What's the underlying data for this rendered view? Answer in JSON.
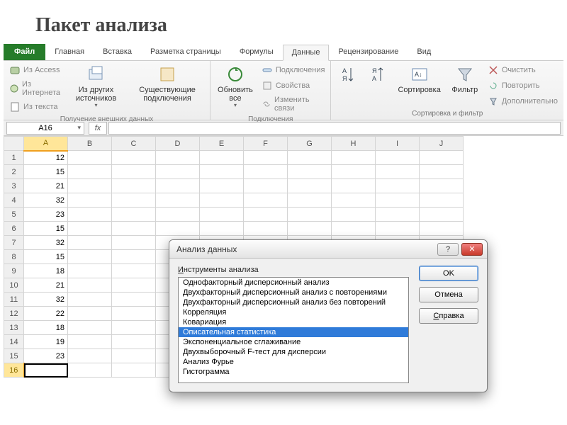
{
  "page_title": "Пакет анализа",
  "tabs": {
    "file": "Файл",
    "home": "Главная",
    "insert": "Вставка",
    "pagelayout": "Разметка страницы",
    "formulas": "Формулы",
    "data": "Данные",
    "review": "Рецензирование",
    "view": "Вид"
  },
  "ribbon": {
    "group_ext_data": {
      "label": "Получение внешних данных",
      "from_access": "Из Access",
      "from_web": "Из Интернета",
      "from_text": "Из текста",
      "from_other": "Из других источников",
      "existing_conn": "Существующие подключения"
    },
    "group_connections": {
      "label": "Подключения",
      "refresh_all": "Обновить все",
      "connections": "Подключения",
      "properties": "Свойства",
      "edit_links": "Изменить связи"
    },
    "group_sort": {
      "label": "Сортировка и фильтр",
      "sort": "Сортировка",
      "filter": "Фильтр",
      "clear": "Очистить",
      "reapply": "Повторить",
      "advanced": "Дополнительно"
    }
  },
  "namebox": "A16",
  "fx": "fx",
  "columns": [
    "A",
    "B",
    "C",
    "D",
    "E",
    "F",
    "G",
    "H",
    "I",
    "J"
  ],
  "rows": [
    {
      "n": "1",
      "a": "12"
    },
    {
      "n": "2",
      "a": "15"
    },
    {
      "n": "3",
      "a": "21"
    },
    {
      "n": "4",
      "a": "32"
    },
    {
      "n": "5",
      "a": "23"
    },
    {
      "n": "6",
      "a": "15"
    },
    {
      "n": "7",
      "a": "32"
    },
    {
      "n": "8",
      "a": "15"
    },
    {
      "n": "9",
      "a": "18"
    },
    {
      "n": "10",
      "a": "21"
    },
    {
      "n": "11",
      "a": "32"
    },
    {
      "n": "12",
      "a": "22"
    },
    {
      "n": "13",
      "a": "18"
    },
    {
      "n": "14",
      "a": "19"
    },
    {
      "n": "15",
      "a": "23"
    },
    {
      "n": "16",
      "a": ""
    }
  ],
  "dialog": {
    "title": "Анализ данных",
    "list_label_pre": "И",
    "list_label_rest": "нструменты анализа",
    "items": [
      "Однофакторный дисперсионный анализ",
      "Двухфакторный дисперсионный анализ с повторениями",
      "Двухфакторный дисперсионный анализ без повторений",
      "Корреляция",
      "Ковариация",
      "Описательная статистика",
      "Экспоненциальное сглаживание",
      "Двухвыборочный F-тест для дисперсии",
      "Анализ Фурье",
      "Гистограмма"
    ],
    "selected_index": 5,
    "ok": "OK",
    "cancel": "Отмена",
    "help_u": "С",
    "help_rest": "правка"
  }
}
